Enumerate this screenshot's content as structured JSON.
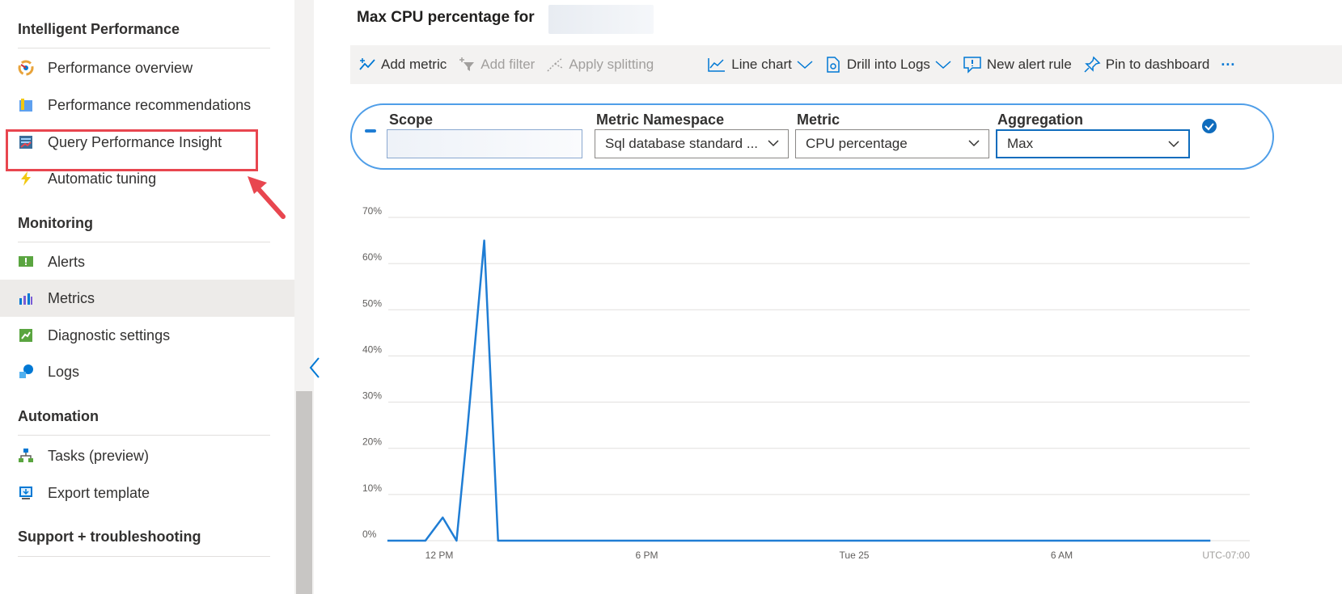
{
  "sidebar": {
    "sections": [
      {
        "title": "Intelligent Performance",
        "items": [
          {
            "label": "Performance overview",
            "icon": "performance-overview-icon"
          },
          {
            "label": "Performance recommendations",
            "icon": "performance-recommendations-icon"
          },
          {
            "label": "Query Performance Insight",
            "icon": "query-performance-insight-icon"
          },
          {
            "label": "Automatic tuning",
            "icon": "lightning-icon"
          }
        ]
      },
      {
        "title": "Monitoring",
        "items": [
          {
            "label": "Alerts",
            "icon": "alerts-icon"
          },
          {
            "label": "Metrics",
            "icon": "metrics-icon"
          },
          {
            "label": "Diagnostic settings",
            "icon": "diagnostic-settings-icon"
          },
          {
            "label": "Logs",
            "icon": "logs-icon"
          }
        ]
      },
      {
        "title": "Automation",
        "items": [
          {
            "label": "Tasks (preview)",
            "icon": "tasks-icon"
          },
          {
            "label": "Export template",
            "icon": "export-template-icon"
          }
        ]
      },
      {
        "title": "Support + troubleshooting",
        "items": []
      }
    ],
    "selected_item": "Metrics",
    "highlighted_item": "Query Performance Insight"
  },
  "main": {
    "title": "Max CPU percentage for",
    "toolbar": {
      "add_metric": "Add metric",
      "add_filter": "Add filter",
      "apply_splitting": "Apply splitting",
      "line_chart": "Line chart",
      "drill_into_logs": "Drill into Logs",
      "new_alert_rule": "New alert rule",
      "pin_to_dashboard": "Pin to dashboard",
      "more": "···"
    },
    "query": {
      "scope_label": "Scope",
      "namespace_label": "Metric Namespace",
      "namespace_value": "Sql database standard ...",
      "metric_label": "Metric",
      "metric_value": "CPU percentage",
      "aggregation_label": "Aggregation",
      "aggregation_value": "Max"
    }
  },
  "colors": {
    "accent": "#0078d4",
    "highlight": "#e8464f",
    "series": "#1f7dd4"
  },
  "chart_data": {
    "type": "line",
    "y_ticks": [
      "70%",
      "60%",
      "50%",
      "40%",
      "30%",
      "20%",
      "10%",
      "0%"
    ],
    "x_ticks": [
      "12 PM",
      "6 PM",
      "Tue 25",
      "6 AM"
    ],
    "timezone": "UTC-07:00",
    "ylim": [
      0,
      70
    ],
    "grid": true,
    "series": [
      {
        "x_hours": [
          -1.5,
          -0.4,
          0.1,
          0.5,
          0.8,
          1.3,
          1.7,
          2.1,
          4,
          8,
          12,
          16,
          20,
          22.3
        ],
        "values": [
          0,
          0,
          5,
          0,
          23,
          65,
          0,
          0,
          0,
          0,
          0,
          0,
          0,
          0
        ]
      }
    ]
  }
}
